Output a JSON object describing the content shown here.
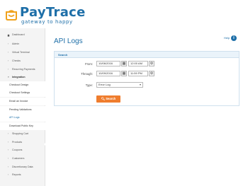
{
  "brand": {
    "name": "PayTrace",
    "tagline": "gateway to happy",
    "primary_color": "#1e6fa8",
    "accent_color": "#ef7d2e",
    "logo_icon": "paytrace-logo-icon"
  },
  "sidebar": {
    "items": [
      {
        "label": "Dashboard",
        "icon": "home-icon",
        "type": "home"
      },
      {
        "label": "Admin",
        "type": "collapsed"
      },
      {
        "label": "Virtual Terminal",
        "type": "collapsed"
      },
      {
        "label": "Checks",
        "type": "collapsed"
      },
      {
        "label": "Recurring Payments",
        "type": "collapsed"
      },
      {
        "label": "Integration",
        "type": "expanded"
      },
      {
        "label": "Checkout Design",
        "type": "sub"
      },
      {
        "label": "Checkout Settings",
        "type": "sub"
      },
      {
        "label": "Email an Invoice",
        "type": "sub"
      },
      {
        "label": "Pending Validations",
        "type": "sub"
      },
      {
        "label": "API Logs",
        "type": "sub-active"
      },
      {
        "label": "Download Public Key",
        "type": "sub"
      },
      {
        "label": "Shopping Cart",
        "type": "collapsed"
      },
      {
        "label": "Products",
        "type": "collapsed"
      },
      {
        "label": "Coupons",
        "type": "collapsed"
      },
      {
        "label": "Customers",
        "type": "collapsed"
      },
      {
        "label": "Discretionary Data",
        "type": "collapsed"
      },
      {
        "label": "Reports",
        "type": "collapsed"
      }
    ]
  },
  "main": {
    "title": "API Logs",
    "help_label": "Help",
    "help_icon": "info-icon",
    "search_panel": {
      "title": "Search",
      "from_label": "From:",
      "from_date": "10/06/2016",
      "from_time": "12:00 AM",
      "through_label": "Through:",
      "through_date": "10/09/2016",
      "through_time": "11:59 PM",
      "type_label": "Type:",
      "type_value": "Error Log",
      "search_button": "Search",
      "calendar_icon": "calendar-icon",
      "clock_settings_icon": "gear-icon",
      "search_icon": "search-icon"
    }
  }
}
